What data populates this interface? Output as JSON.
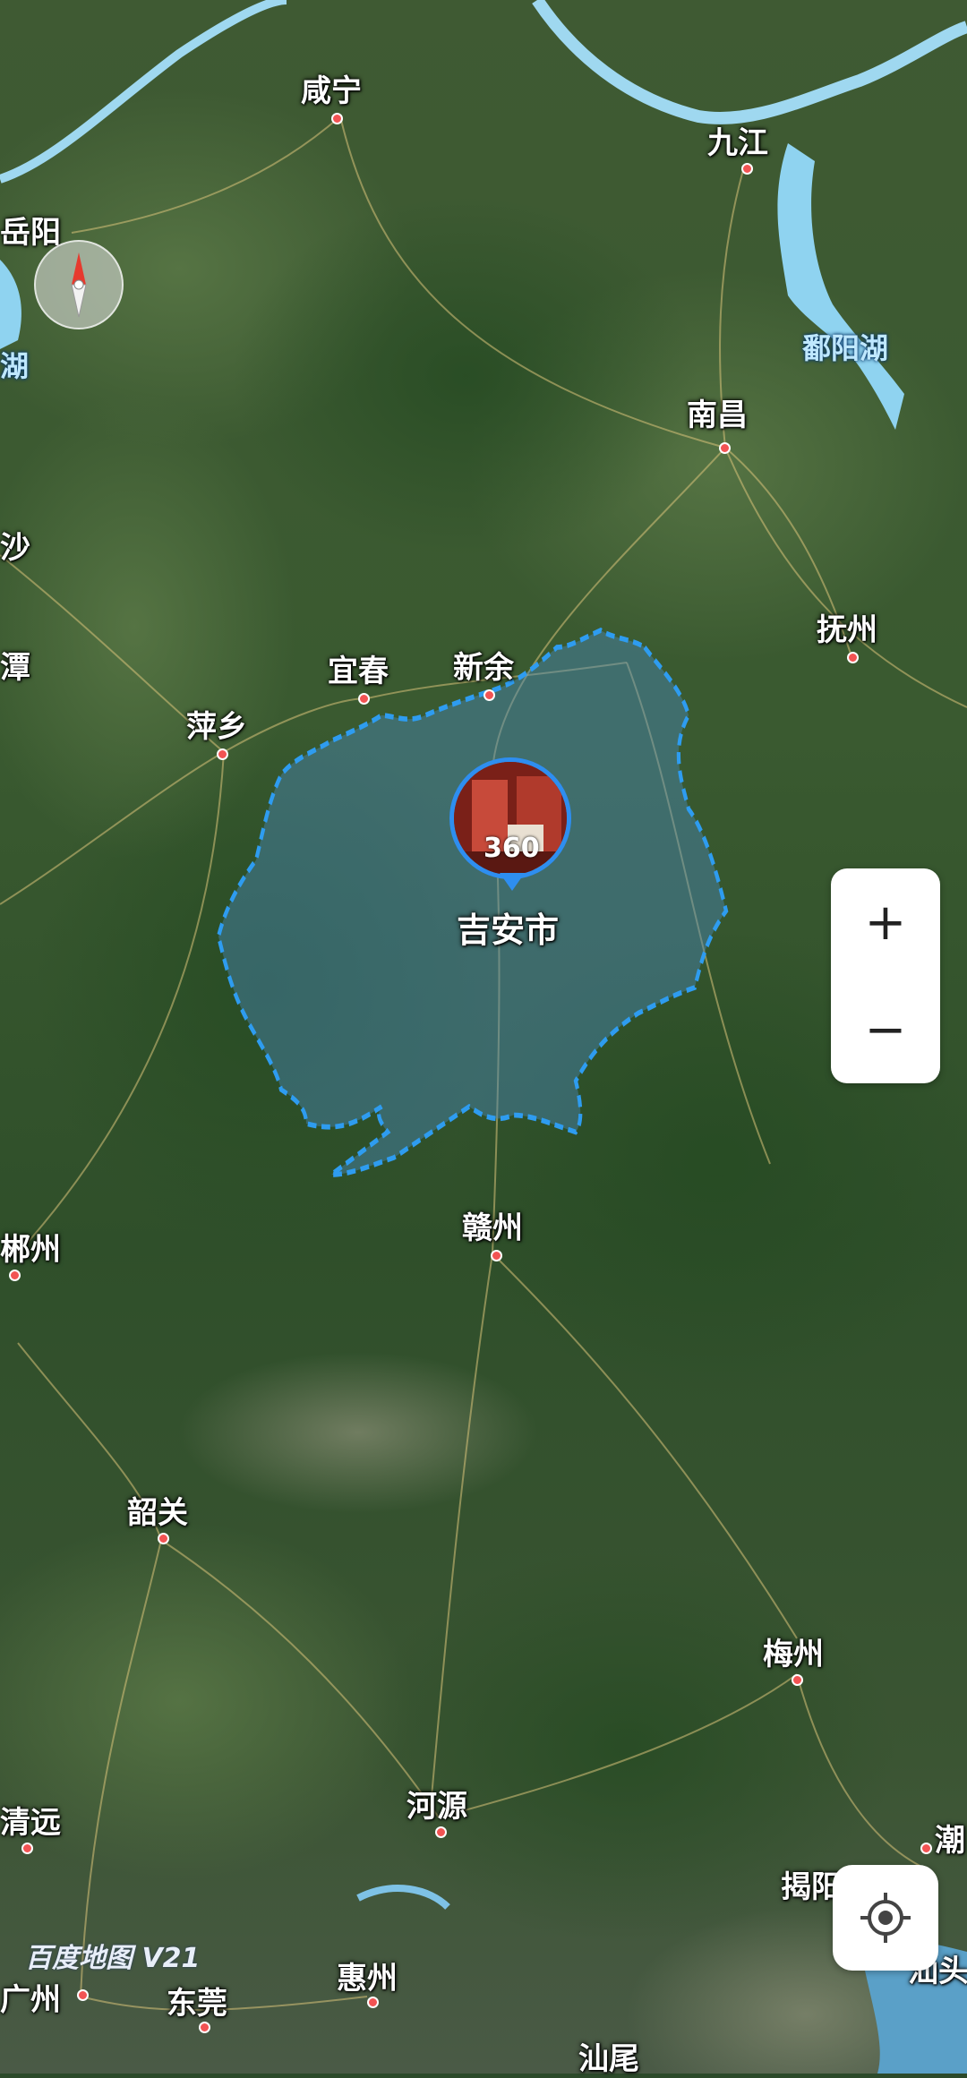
{
  "map": {
    "cities": [
      {
        "name": "咸宁"
      },
      {
        "name": "九江"
      },
      {
        "name": "岳阳"
      },
      {
        "name": "南昌"
      },
      {
        "name": "沙"
      },
      {
        "name": "潭"
      },
      {
        "name": "抚州"
      },
      {
        "name": "宜春"
      },
      {
        "name": "新余"
      },
      {
        "name": "萍乡"
      },
      {
        "name": "赣州"
      },
      {
        "name": "郴州"
      },
      {
        "name": "韶关"
      },
      {
        "name": "梅州"
      },
      {
        "name": "清远"
      },
      {
        "name": "河源"
      },
      {
        "name": "揭阳"
      },
      {
        "name": "潮"
      },
      {
        "name": "惠州"
      },
      {
        "name": "东莞"
      },
      {
        "name": "广州"
      },
      {
        "name": "汕头"
      },
      {
        "name": "汕尾"
      }
    ],
    "water_labels": [
      "鄱阳湖",
      "湖"
    ],
    "highlighted_region": {
      "name": "吉安市",
      "boundary_color": "#2e9cf0"
    },
    "pin": {
      "label": "360"
    },
    "watermark": "百度地图 V21"
  },
  "controls": {
    "compass": {
      "icon": "compass-icon"
    },
    "zoom_in_label": "+",
    "zoom_out_label": "−",
    "locate": {
      "icon": "locate-icon"
    }
  }
}
